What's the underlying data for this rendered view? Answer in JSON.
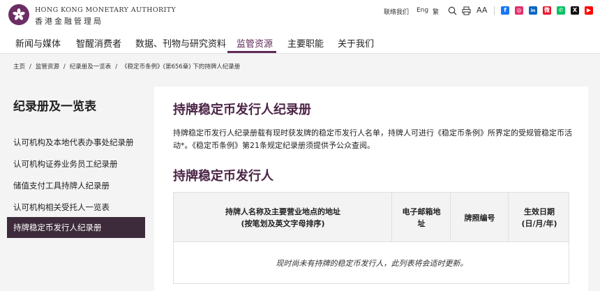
{
  "brand": {
    "name_en": "HONG KONG MONETARY AUTHORITY",
    "name_zh": "香港金融管理局"
  },
  "utility": {
    "contact": "联络我们",
    "lang_en": "Eng",
    "lang_tc": "繁",
    "font_size": "AA"
  },
  "social": [
    {
      "icon": "facebook-icon",
      "glyph": "f",
      "color": "#1877f2"
    },
    {
      "icon": "instagram-icon",
      "glyph": "◎",
      "color": "#e1306c"
    },
    {
      "icon": "linkedin-icon",
      "glyph": "in",
      "color": "#0a66c2"
    },
    {
      "icon": "weibo-icon",
      "glyph": "微",
      "color": "#e6162d"
    },
    {
      "icon": "wechat-icon",
      "glyph": "✆",
      "color": "#07c160"
    },
    {
      "icon": "x-icon",
      "glyph": "X",
      "color": "#111111"
    },
    {
      "icon": "youtube-icon",
      "glyph": "▶",
      "color": "#ff0000"
    }
  ],
  "nav": {
    "items": [
      "新闻与媒体",
      "智醒消费者",
      "数据、刊物与研究资料",
      "监管资源",
      "主要职能",
      "关于我们"
    ],
    "active_index": 3
  },
  "breadcrumb": [
    "主页",
    "/",
    "监管资源",
    "/",
    "纪录册及一览表",
    "/",
    "《稳定币条例》(第656章) 下的持牌人纪录册"
  ],
  "sidebar": {
    "title": "纪录册及一览表",
    "items": [
      "认可机构及本地代表办事处纪录册",
      "认可机构证券业务员工纪录册",
      "储值支付工具持牌人纪录册",
      "认可机构相关受托人一览表",
      "持牌稳定币发行人纪录册"
    ],
    "active_index": 4
  },
  "main": {
    "title": "持牌稳定币发行人纪录册",
    "intro": "持牌稳定币发行人纪录册载有现时获发牌的稳定币发行人名单，持牌人可进行《稳定币条例》所界定的受规管稳定币活动*。《稳定币条例》第21条规定纪录册须提供予公众查阅。",
    "section_title": "持牌稳定币发行人",
    "table": {
      "headers": [
        "持牌人名称及主要营业地点的地址\n(按笔划及英文字母排序)",
        "电子邮箱地\n址",
        "牌照编号",
        "生效日期\n(日/月/年)"
      ],
      "empty_message": "现时尚未有持牌的稳定币发行人，此列表将会适时更新。"
    }
  },
  "colors": {
    "brand_purple": "#5e2a57",
    "heading_purple": "#4b2446",
    "sidebar_active": "#3d2b3b"
  }
}
